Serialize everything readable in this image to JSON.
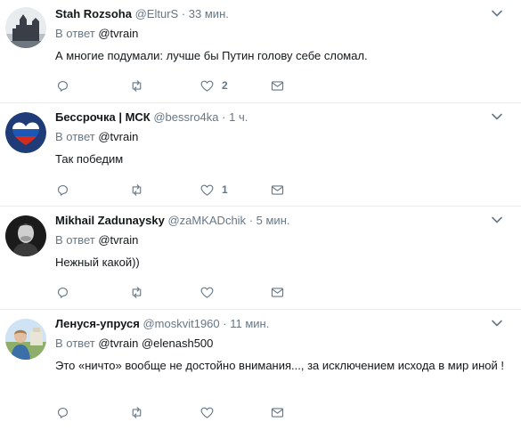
{
  "reply_prefix": "В ответ",
  "tweets": [
    {
      "name": "Stah Rozsoha",
      "handle": "@ElturS",
      "separator": "·",
      "time": "33 мин.",
      "reply_to": [
        "@tvrain"
      ],
      "text": "А многие подумали: лучше бы Путин голову себе сломал.",
      "likes": "2",
      "avatar": "castle-silhouette"
    },
    {
      "name": "Бессрочка | МСК",
      "handle": "@bessro4ka",
      "separator": "·",
      "time": "1 ч.",
      "reply_to": [
        "@tvrain"
      ],
      "text": "Так победим",
      "likes": "1",
      "avatar": "russian-flag-heart"
    },
    {
      "name": "Mikhail Zadunaysky",
      "handle": "@zaMKADchik",
      "separator": "·",
      "time": "5 мин.",
      "reply_to": [
        "@tvrain"
      ],
      "text": "Нежный какой))",
      "likes": "",
      "avatar": "man-portrait-bw"
    },
    {
      "name": "Ленуся-упруся",
      "handle": "@moskvit1960",
      "separator": "·",
      "time": "11 мин.",
      "reply_to": [
        "@tvrain",
        "@elenash500"
      ],
      "text": "Это «ничто» вообще не достойно внимания..., за исключением исхода в мир иной !",
      "likes": "",
      "avatar": "woman-outdoor-photo"
    }
  ],
  "colors": {
    "secondary": "#657786",
    "text": "#14171a",
    "divider": "#e6ecf0"
  }
}
